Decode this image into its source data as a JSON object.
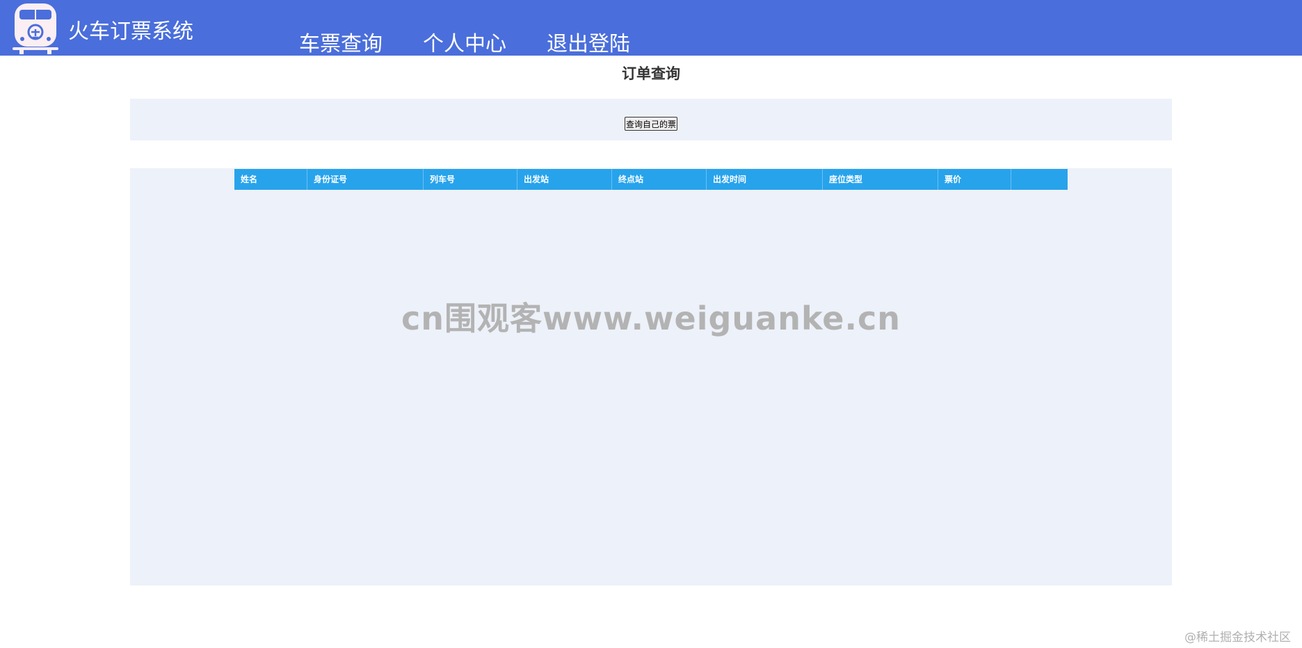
{
  "header": {
    "title": "火车订票系统",
    "logo_icon": "train-icon",
    "nav": [
      {
        "label": "车票查询"
      },
      {
        "label": "个人中心"
      },
      {
        "label": "退出登陆"
      }
    ]
  },
  "main": {
    "title": "订单查询",
    "query_button": "查询自己的票",
    "table": {
      "columns": [
        "姓名",
        "身份证号",
        "列车号",
        "出发站",
        "终点站",
        "出发时间",
        "座位类型",
        "票价",
        ""
      ],
      "rows": []
    }
  },
  "watermark": "cn围观客www.weiguanke.cn",
  "corner_mark": "@稀土掘金技术社区",
  "colors": {
    "header_bg": "#4a6edb",
    "panel_bg": "#edf1f9",
    "table_header_bg": "#27a3ec"
  }
}
